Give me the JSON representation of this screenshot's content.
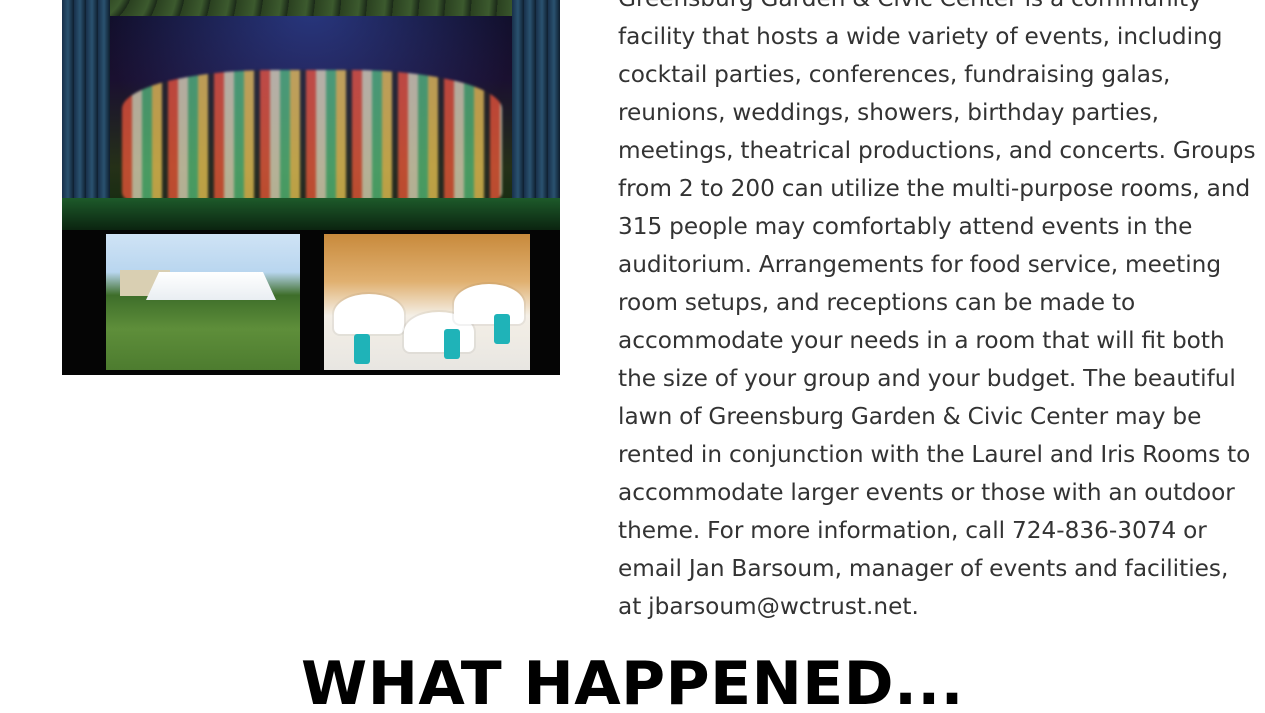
{
  "images": {
    "collage_alt": "",
    "thumbnails": [
      "lawn-tent-photo",
      "banquet-room-photo"
    ]
  },
  "content": {
    "paragraph": "Greensburg Garden & Civic Center is a community facility that hosts a wide variety of events, including cocktail parties, conferences, fundraising galas, reunions, weddings, showers, birthday parties, meetings, theatrical productions, and concerts. Groups from 2 to 200 can utilize the multi-purpose rooms, and 315 people may comfortably attend events in the auditorium. Arrangements for food service, meeting room setups, and receptions can be made to accommodate your needs in a room that will fit both the size of your group and your budget. The beautiful lawn of Greensburg Garden & Civic Center may be rented in conjunction with the Laurel and Iris Rooms to accommodate larger events or those with an outdoor theme. For more information, call 724-836-3074 or email Jan Barsoum, manager of events and facilities, at jbarsoum@wctrust.net.",
    "heading": "WHAT HAPPENED..."
  },
  "colors": {
    "text": "#333333",
    "heading": "#000000",
    "background": "#ffffff"
  }
}
